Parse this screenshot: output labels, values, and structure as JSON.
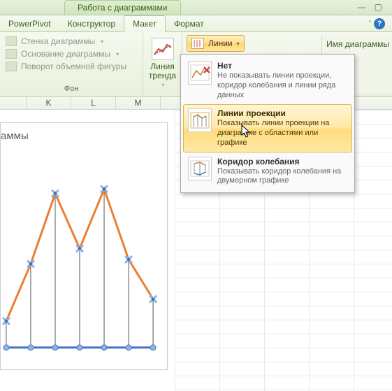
{
  "titlebar": {
    "context_title": "Работа с диаграммами"
  },
  "tabs": {
    "powerpivot": "PowerPivot",
    "constructor": "Конструктор",
    "layout": "Макет",
    "format": "Формат"
  },
  "ribbon": {
    "group_background": {
      "wall": "Стенка диаграммы",
      "base": "Основание диаграммы",
      "rotate3d": "Поворот объемной фигуры",
      "group_label": "Фон"
    },
    "trendline": {
      "label_line1": "Линия",
      "label_line2": "тренда"
    },
    "lines_button": "Линии",
    "chart_name_label": "Имя диаграммы"
  },
  "lines_menu": {
    "none": {
      "title": "Нет",
      "desc": "Не показывать линии проекции, коридор колебания и линии ряда данных"
    },
    "projection": {
      "title": "Линии проекции",
      "desc": "Показывать линии проекции на диаграмме с областями или графике"
    },
    "hilo": {
      "title": "Коридор колебания",
      "desc": "Показывать коридор колебания на двумерном графике"
    }
  },
  "columns": {
    "k": "K",
    "l": "L",
    "m": "M"
  },
  "chart": {
    "title_visible_fragment": "аммы"
  },
  "chart_data": {
    "type": "line",
    "title": "аммы",
    "x": [
      1,
      2,
      3,
      4,
      5,
      6,
      7
    ],
    "values": [
      12,
      38,
      70,
      45,
      72,
      40,
      22
    ],
    "has_drop_lines": true,
    "marker": "x-blue",
    "line_color": "#ed7d31",
    "ylim": [
      0,
      80
    ]
  }
}
